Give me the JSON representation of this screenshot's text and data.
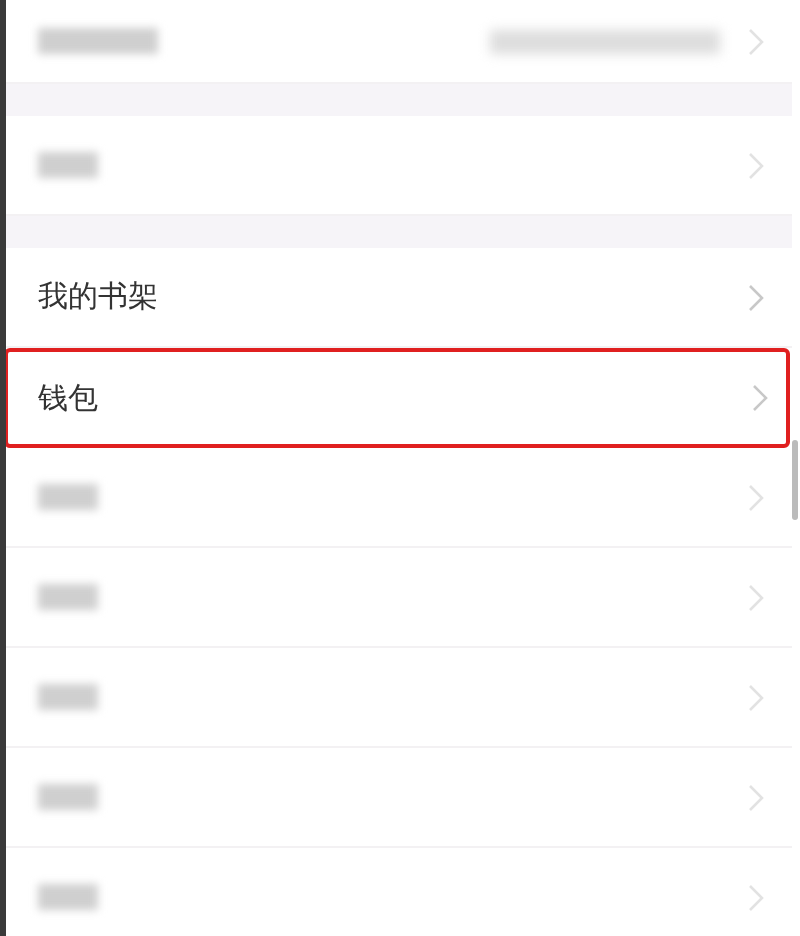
{
  "sections": [
    {
      "items": [
        {
          "kind": "blurred_with_value",
          "highlighted": false
        }
      ]
    },
    {
      "items": [
        {
          "kind": "blurred",
          "highlighted": false
        }
      ]
    },
    {
      "items": [
        {
          "kind": "text",
          "label": "我的书架",
          "highlighted": false
        },
        {
          "kind": "text",
          "label": "钱包",
          "highlighted": true
        },
        {
          "kind": "blurred",
          "highlighted": false
        },
        {
          "kind": "blurred",
          "highlighted": false
        },
        {
          "kind": "blurred",
          "highlighted": false
        },
        {
          "kind": "blurred",
          "highlighted": false
        },
        {
          "kind": "blurred",
          "highlighted": false
        }
      ]
    }
  ]
}
